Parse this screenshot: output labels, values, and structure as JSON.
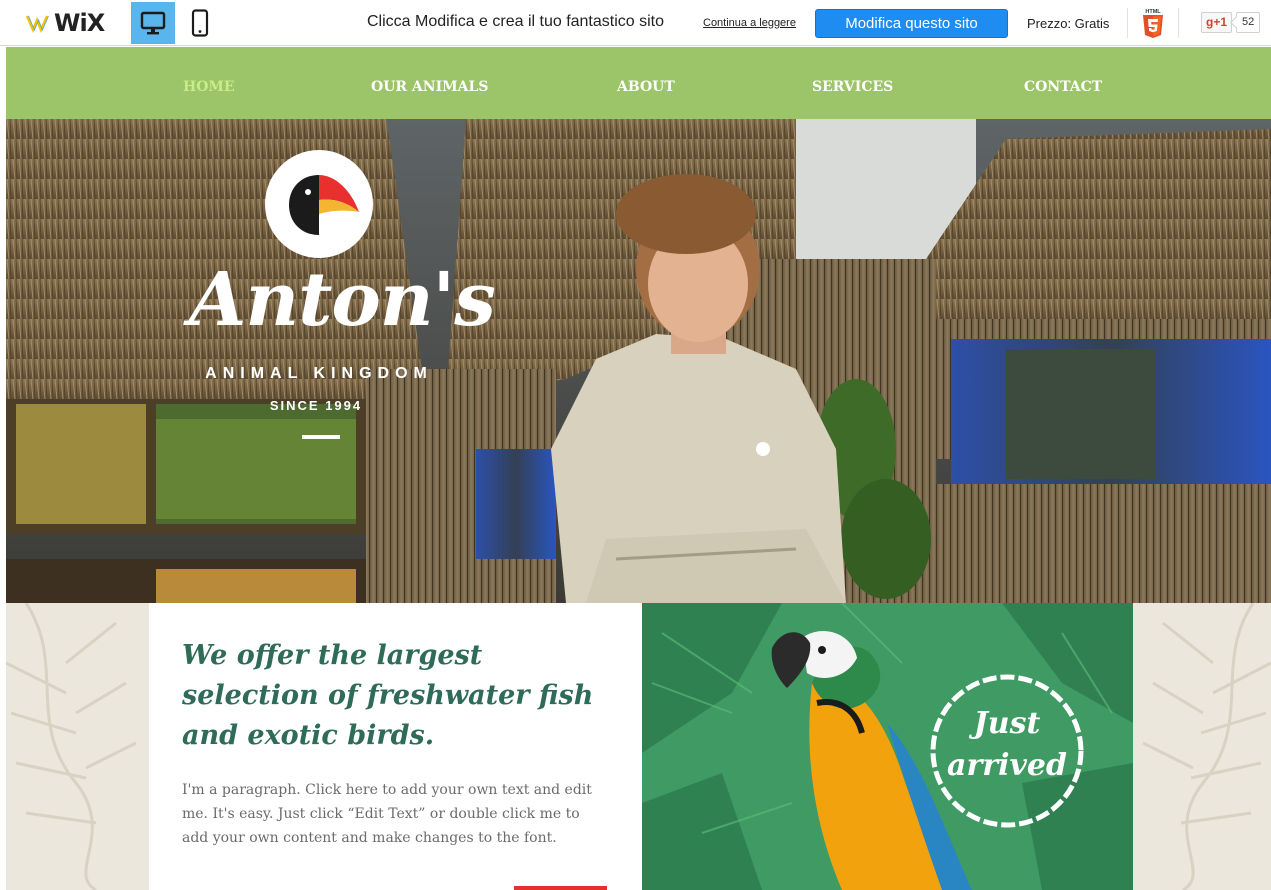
{
  "wixbar": {
    "logo_text": "WiX",
    "promo_text": "Clicca Modifica e crea il tuo fantastico sito",
    "promo_link": "Continua a leggere",
    "edit_button": "Modifica questo sito",
    "price": "Prezzo: Gratis",
    "gplus_label": "g+1",
    "gplus_count": "52",
    "html5_label": "HTML"
  },
  "nav": {
    "items": [
      {
        "label": "HOME",
        "active": true
      },
      {
        "label": "OUR ANIMALS",
        "active": false
      },
      {
        "label": "ABOUT",
        "active": false
      },
      {
        "label": "SERVICES",
        "active": false
      },
      {
        "label": "CONTACT",
        "active": false
      }
    ]
  },
  "hero": {
    "brand_name": "Anton's",
    "brand_sub": "ANIMAL KINGDOM",
    "brand_since": "SINCE 1994"
  },
  "intro": {
    "headline": "We offer the largest selection of freshwater fish and exotic birds.",
    "paragraph": "I'm a paragraph. Click here to add your own text and edit me. It's easy. Just click “Edit Text” or double click me to add your own content and make changes to the font."
  },
  "promo_panel": {
    "badge": "Just arrived"
  },
  "colors": {
    "nav_bg": "#9cc56a",
    "nav_active": "#c8ec8a",
    "headline": "#2e6b58",
    "edit_button": "#1e8cf0",
    "accent_red": "#e6302f",
    "panel_green": "#3f9a64"
  },
  "icons": [
    "wix-logo-icon",
    "desktop-view-icon",
    "mobile-view-icon",
    "html5-icon",
    "toucan-logo-icon",
    "parrot-image"
  ]
}
